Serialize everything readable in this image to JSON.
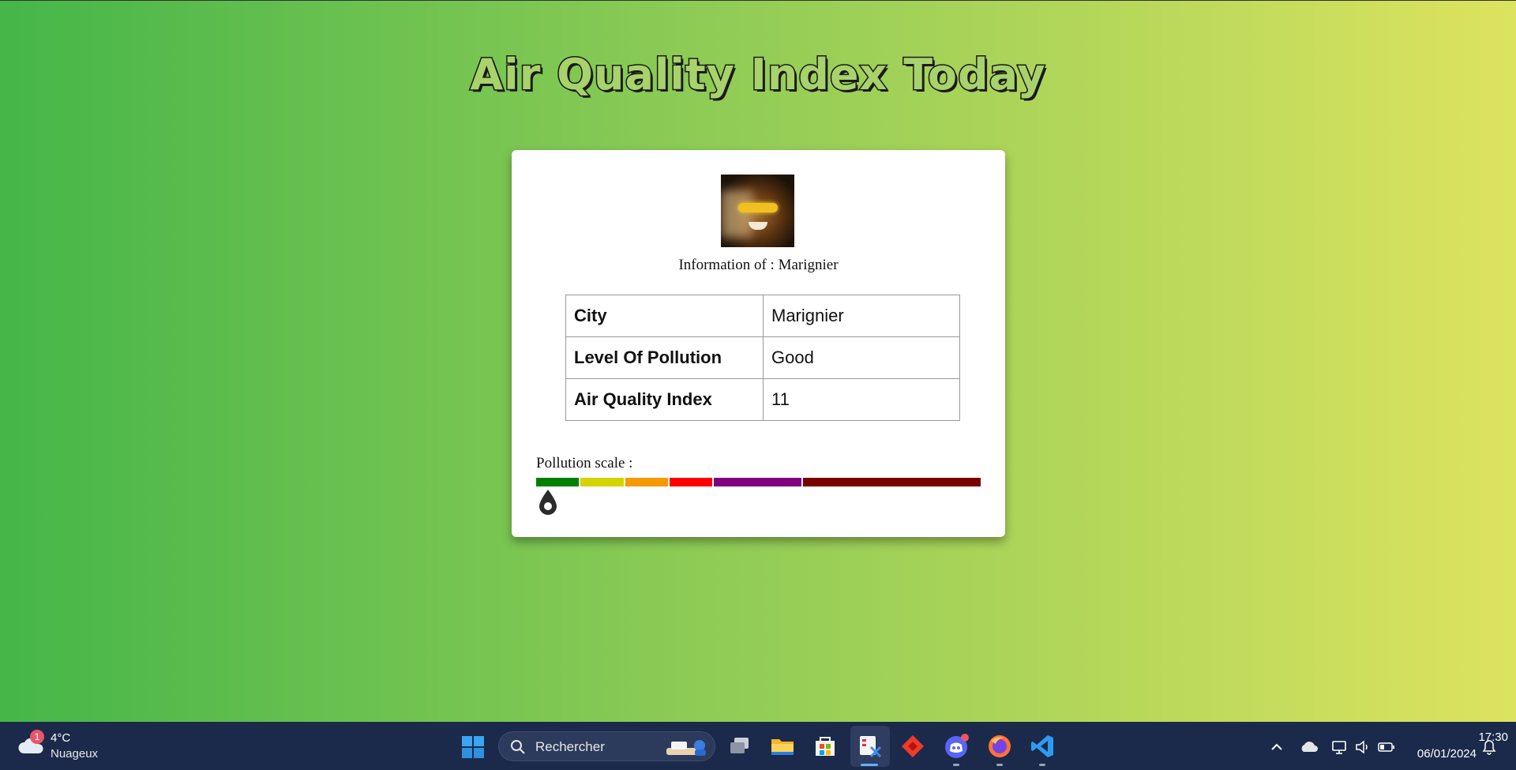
{
  "page": {
    "title": "Air Quality Index Today",
    "info_prefix": "Information of : ",
    "city_name": "Marignier"
  },
  "table": {
    "rows": [
      {
        "label": "City",
        "value": "Marignier"
      },
      {
        "label": "Level Of Pollution",
        "value": "Good"
      },
      {
        "label": "Air Quality Index",
        "value": "11"
      }
    ]
  },
  "scale": {
    "label": "Pollution scale :",
    "marker_aqi": 11,
    "segments": [
      {
        "name": "good",
        "color": "#008000",
        "from": 0,
        "to": 50
      },
      {
        "name": "moderate",
        "color": "#d4d400",
        "from": 50,
        "to": 100
      },
      {
        "name": "unhealthy-sensitive",
        "color": "#f59a00",
        "from": 100,
        "to": 150
      },
      {
        "name": "unhealthy",
        "color": "#ff0000",
        "from": 150,
        "to": 200
      },
      {
        "name": "very-unhealthy",
        "color": "#800080",
        "from": 200,
        "to": 300
      },
      {
        "name": "hazardous",
        "color": "#7a0000",
        "from": 300,
        "to": 500
      }
    ]
  },
  "taskbar": {
    "weather_badge": "1",
    "weather_temp": "4°C",
    "weather_desc": "Nuageux",
    "search_placeholder": "Rechercher",
    "clock_time": "17:30",
    "clock_date": "06/01/2024",
    "icons": [
      "start-icon",
      "task-view-icon",
      "file-explorer-icon",
      "microsoft-store-icon",
      "snipping-tool-icon",
      "anydesk-icon",
      "discord-icon",
      "firefox-icon",
      "vscode-icon"
    ]
  }
}
